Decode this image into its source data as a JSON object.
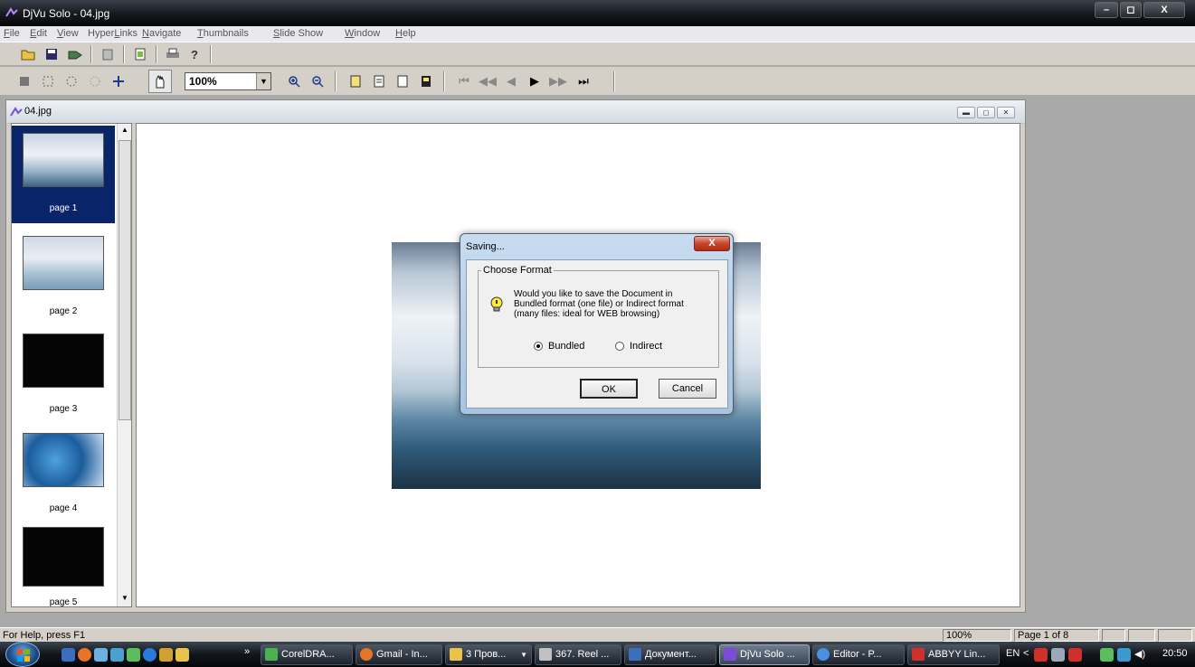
{
  "window": {
    "title": "DjVu Solo - 04.jpg",
    "minimize": "–",
    "maximize": "◻",
    "close": "X"
  },
  "menubar": [
    {
      "pre": "",
      "u": "F",
      "post": "ile"
    },
    {
      "pre": "",
      "u": "E",
      "post": "dit"
    },
    {
      "pre": "",
      "u": "V",
      "post": "iew"
    },
    {
      "pre": "Hyper",
      "u": "L",
      "post": "inks"
    },
    {
      "pre": "",
      "u": "N",
      "post": "avigate"
    },
    {
      "pre": "",
      "u": "T",
      "post": "humbnails"
    },
    {
      "pre": "",
      "u": "S",
      "post": "lide Show"
    },
    {
      "pre": "",
      "u": "W",
      "post": "indow"
    },
    {
      "pre": "",
      "u": "H",
      "post": "elp"
    }
  ],
  "toolbar": {
    "zoom_value": "100%"
  },
  "document": {
    "title": "04.jpg"
  },
  "thumbnails": [
    "page 1",
    "page 2",
    "page 3",
    "page 4",
    "page 5"
  ],
  "dialog": {
    "title": "Saving...",
    "close_label": "X",
    "group_label": "Choose Format",
    "message_line1": "Would you like to save the Document in",
    "message_line2": "Bundled format (one file) or Indirect format",
    "message_line3": "(many files: ideal for WEB browsing)",
    "option_bundled": "Bundled",
    "option_indirect": "Indirect",
    "selected": "Bundled",
    "ok": "OK",
    "cancel": "Cancel"
  },
  "status": {
    "help": "For Help, press F1",
    "zoom": "100%",
    "page": "Page 1 of 8"
  },
  "taskbar": {
    "overflow": "»",
    "tasks": [
      "CorelDRA...",
      "Gmail - In...",
      "3 Пров...",
      "367. Reel ...",
      "Документ...",
      "DjVu Solo ...",
      "Editor - P...",
      "ABBYY Lin..."
    ],
    "lang": "EN",
    "tray_arrow": "<",
    "clock": "20:50"
  },
  "colors": {
    "selection": "#0a246a",
    "titlebar": "#15181d",
    "taskbar": "#12161c"
  }
}
